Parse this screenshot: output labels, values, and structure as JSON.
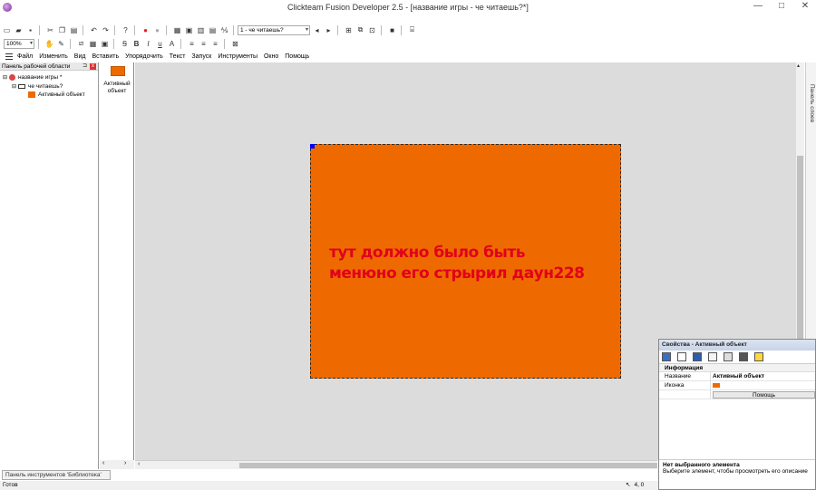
{
  "window": {
    "title": "Clickteam Fusion Developer 2.5 - [название игры - че читаешь?*]",
    "controls": [
      "—",
      "□",
      "✕"
    ]
  },
  "toolbar": {
    "zoom": "100%",
    "frame_select": "1 - че читаешь?"
  },
  "menu": {
    "items": [
      "Файл",
      "Изменить",
      "Вид",
      "Вставить",
      "Упорядочить",
      "Текст",
      "Запуск",
      "Инструменты",
      "Окно",
      "Помощь"
    ]
  },
  "workspace": {
    "title": "Панель рабочей области",
    "pin": "⊐",
    "close": "x",
    "tree": {
      "game": "название игры *",
      "frame": "че читаешь?",
      "object": "Активный объект"
    }
  },
  "object_bar": {
    "label": "Активный объект"
  },
  "frame": {
    "text_line1": "тут должно было быть",
    "text_line2": "менюно его стрырил даун228",
    "background_color": "#ee6a00",
    "text_color": "#e1001d"
  },
  "layers_tab": {
    "label": "Панель слоев"
  },
  "properties": {
    "title": "Свойства - Активный объект",
    "section": "Информация",
    "rows": [
      {
        "key": "Название",
        "value": "Активный объект"
      },
      {
        "key": "Иконка",
        "value": ""
      }
    ],
    "help_label": "Помощь",
    "footer_title": "Нет выбранного элемента",
    "footer_text": "Выберите элемент, чтобы просмотреть его описание"
  },
  "library_tab": {
    "label": "Панель инструментов 'Библиотека'"
  },
  "status": {
    "text": "Готов",
    "coords": "4, 0"
  }
}
